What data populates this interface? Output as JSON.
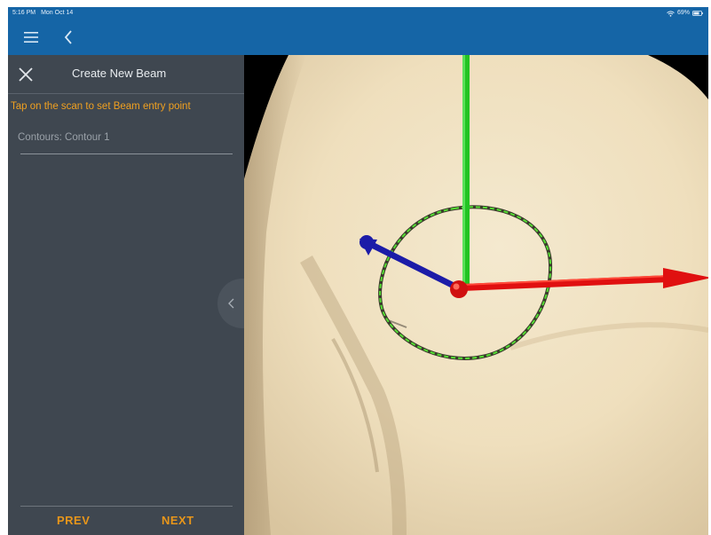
{
  "status_bar": {
    "time": "5:16 PM",
    "date": "Mon Oct 14",
    "battery": "69%"
  },
  "nav": {
    "menu_icon": "hamburger-menu-icon",
    "back_icon": "chevron-left-icon"
  },
  "panel": {
    "close_icon": "close-x-icon",
    "title": "Create New Beam",
    "instruction": "Tap on the scan to set Beam entry point",
    "contours_label": "Contours: Contour 1",
    "collapse_icon": "chevron-left-icon",
    "prev_label": "PREV",
    "next_label": "NEXT"
  },
  "colors": {
    "header_blue": "#1565a6",
    "panel_bg": "#3f4750",
    "instruction_orange": "#f0a020",
    "button_orange": "#e8961a",
    "axis_x": "#e01010",
    "axis_y": "#22c322",
    "axis_z": "#1c1ca8",
    "contour_green": "#55dd33"
  }
}
